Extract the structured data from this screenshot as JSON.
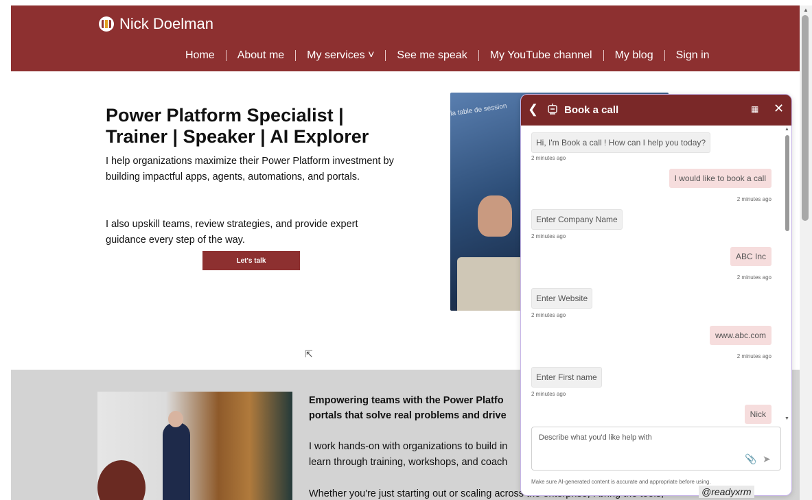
{
  "brand": {
    "name": "Nick Doelman",
    "logo_icon": "podcast-logo-icon"
  },
  "nav": {
    "items": [
      "Home",
      "About me",
      "My services ˅",
      "See me speak",
      "My YouTube channel",
      "My blog",
      "Sign in"
    ]
  },
  "hero": {
    "title": "Power Platform Specialist | Trainer | Speaker | AI Explorer",
    "p1": "I help organizations maximize their Power Platform investment by building impactful apps, agents, automations, and portals.",
    "p2": "I also upskill teams, review strategies, and provide expert guidance every step of the way.",
    "cta": "Let's talk",
    "photo_caption": "la table de session"
  },
  "band": {
    "title": "Empowering teams with the Power Platform ... portals that solve real problems and drive ...",
    "title_visible": "Empowering teams with the Power Platfo",
    "title_visible2": "portals that solve real problems and drive",
    "p1a": "I work hands-on with organizations to build in",
    "p1b": "learn through training, workshops, and coach",
    "p2": "Whether you're just starting out or scaling across the enterprise, I bring the tools,"
  },
  "chat": {
    "title": "Book a call",
    "messages": [
      {
        "from": "bot",
        "text": "Hi, I'm Book a call ! How can I help you today?",
        "time": "2 minutes ago"
      },
      {
        "from": "user",
        "text": "I would like to book a call",
        "time": "2 minutes ago"
      },
      {
        "from": "bot",
        "text": "Enter Company Name",
        "time": "2 minutes ago"
      },
      {
        "from": "user",
        "text": "ABC Inc",
        "time": "2 minutes ago"
      },
      {
        "from": "bot",
        "text": "Enter Website",
        "time": "2 minutes ago"
      },
      {
        "from": "user",
        "text": "www.abc.com",
        "time": "2 minutes ago"
      },
      {
        "from": "bot",
        "text": "Enter First name",
        "time": "2 minutes ago"
      },
      {
        "from": "user",
        "text": "Nick",
        "time": ""
      }
    ],
    "input_placeholder": "Describe what you'd like help with",
    "disclaimer": "Make sure AI-generated content is accurate and appropriate before using."
  },
  "watermark": "@readyxrm",
  "colors": {
    "brand": "#8d3030",
    "chat_header": "#7a2828",
    "user_bubble": "#f6dddd"
  }
}
